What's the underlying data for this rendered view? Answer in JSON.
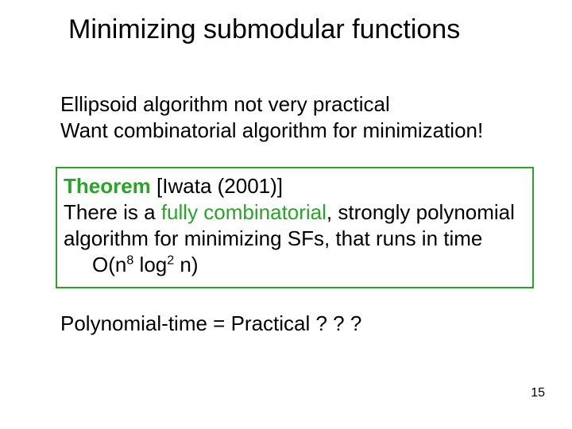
{
  "title": "Minimizing submodular functions",
  "intro": {
    "line1": "Ellipsoid algorithm not very practical",
    "line2": "Want combinatorial algorithm for minimization!"
  },
  "theorem": {
    "label": "Theorem",
    "cite": " [Iwata (2001)]",
    "body_prefix": "There is a ",
    "body_emph": "fully combinatorial",
    "body_suffix1": ", strongly polynomial algorithm for minimizing SFs, that runs in time",
    "complexity_prefix": "O(n",
    "exp1": "8",
    "complexity_mid": " log",
    "exp2": "2",
    "complexity_suffix": " n)"
  },
  "closing": "Polynomial-time = Practical ? ? ?",
  "page": "15"
}
